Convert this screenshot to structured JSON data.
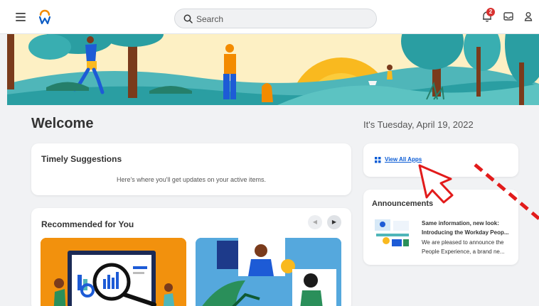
{
  "header": {
    "menu_icon": "hamburger-menu-icon",
    "logo_icon": "workday-logo-icon",
    "search": {
      "placeholder": "Search",
      "icon": "search-icon"
    },
    "notifications": {
      "icon": "bell-icon",
      "count": "2"
    },
    "inbox_icon": "inbox-icon",
    "profile_icon": "user-icon",
    "accent_color": "#f38b00",
    "badge_color": "#d8312f"
  },
  "main": {
    "welcome": "Welcome",
    "date": "It's Tuesday, April 19, 2022",
    "timely": {
      "title": "Timely Suggestions",
      "subtitle": "Here's where you'll get updates on your active items."
    },
    "recommended": {
      "title": "Recommended for You",
      "prev_icon": "chevron-left-icon",
      "next_icon": "chevron-right-icon"
    }
  },
  "side": {
    "apps": {
      "label": "View All Apps",
      "icon": "grid-icon",
      "link_color": "#0b5cd5"
    },
    "announcements": {
      "title": "Announcements",
      "item_title_1": "Same information, new look:",
      "item_title_2": "Introducing the Workday Peop...",
      "item_body_1": "We are pleased to announce the",
      "item_body_2": "People Experience, a brand ne..."
    }
  },
  "annotation_color": "#e21b1b"
}
